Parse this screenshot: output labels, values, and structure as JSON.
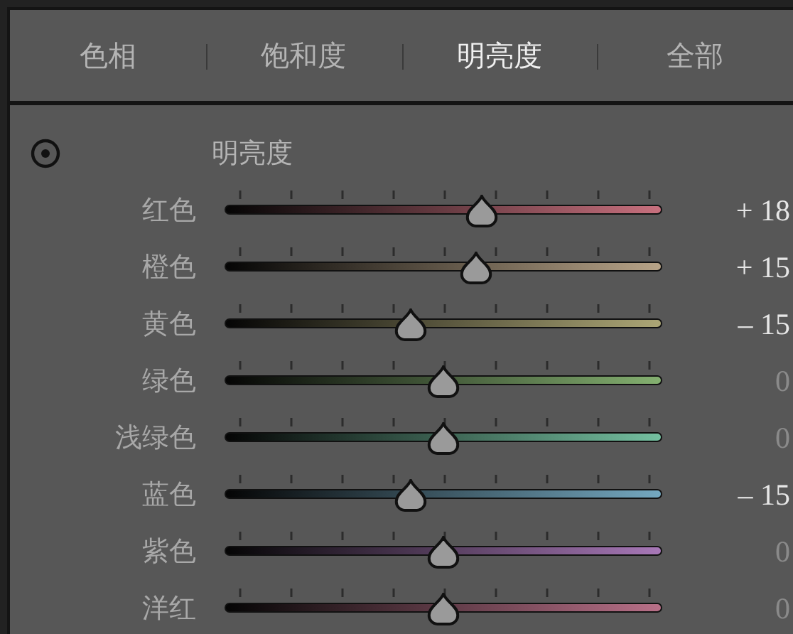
{
  "tabs": [
    {
      "label": "色相",
      "selected": false
    },
    {
      "label": "饱和度",
      "selected": false
    },
    {
      "label": "明亮度",
      "selected": true
    },
    {
      "label": "全部",
      "selected": false
    }
  ],
  "section": {
    "title": "明亮度"
  },
  "rows": [
    {
      "label": "红色",
      "color": "#c8707e",
      "level": 0.59,
      "value": "+ 18",
      "muted": false
    },
    {
      "label": "橙色",
      "color": "#b8a488",
      "level": 0.575,
      "value": "+ 15",
      "muted": false
    },
    {
      "label": "黄色",
      "color": "#aca676",
      "level": 0.425,
      "value": "– 15",
      "muted": false
    },
    {
      "label": "绿色",
      "color": "#84b070",
      "level": 0.5,
      "value": "0",
      "muted": true
    },
    {
      "label": "浅绿色",
      "color": "#74c0a0",
      "level": 0.5,
      "value": "0",
      "muted": true
    },
    {
      "label": "蓝色",
      "color": "#74a8c0",
      "level": 0.425,
      "value": "– 15",
      "muted": false
    },
    {
      "label": "紫色",
      "color": "#a878b8",
      "level": 0.5,
      "value": "0",
      "muted": true
    },
    {
      "label": "洋红",
      "color": "#b87088",
      "level": 0.5,
      "value": "0",
      "muted": true
    }
  ]
}
